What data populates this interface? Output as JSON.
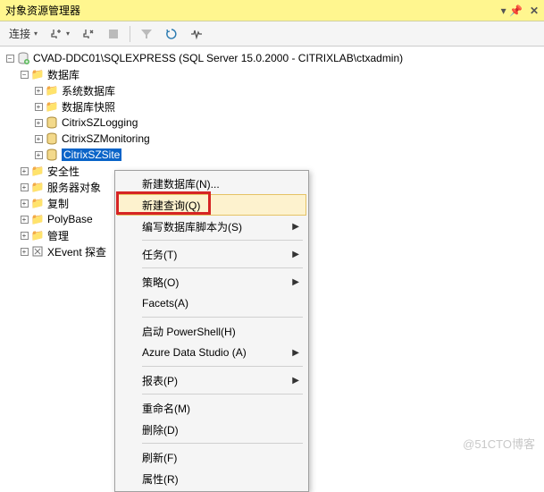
{
  "window": {
    "title": "对象资源管理器",
    "pin_icon": "📌",
    "close_icon": "✕"
  },
  "toolbar": {
    "connect_label": "连接",
    "icons": {
      "plug_add": "plug-add",
      "plug_remove": "plug-remove",
      "stop": "stop",
      "filter": "filter",
      "refresh": "refresh",
      "activity": "activity"
    }
  },
  "tree": {
    "server": "CVAD-DDC01\\SQLEXPRESS (SQL Server 15.0.2000 - CITRIXLAB\\ctxadmin)",
    "nodes": {
      "databases": "数据库",
      "sys_db": "系统数据库",
      "snapshots": "数据库快照",
      "db1": "CitrixSZLogging",
      "db2": "CitrixSZMonitoring",
      "db3": "CitrixSZSite",
      "security": "安全性",
      "server_objects": "服务器对象",
      "replication": "复制",
      "polybase": "PolyBase",
      "management": "管理",
      "xevent": "XEvent 探查"
    }
  },
  "context_menu": {
    "items": [
      {
        "label": "新建数据库(N)...",
        "submenu": false
      },
      {
        "label": "新建查询(Q)",
        "submenu": false,
        "highlight": true
      },
      {
        "label": "编写数据库脚本为(S)",
        "submenu": true
      },
      {
        "sep": true
      },
      {
        "label": "任务(T)",
        "submenu": true
      },
      {
        "sep": true
      },
      {
        "label": "策略(O)",
        "submenu": true
      },
      {
        "label": "Facets(A)",
        "submenu": false
      },
      {
        "sep": true
      },
      {
        "label": "启动 PowerShell(H)",
        "submenu": false
      },
      {
        "label": "Azure Data Studio (A)",
        "submenu": true
      },
      {
        "sep": true
      },
      {
        "label": "报表(P)",
        "submenu": true
      },
      {
        "sep": true
      },
      {
        "label": "重命名(M)",
        "submenu": false
      },
      {
        "label": "删除(D)",
        "submenu": false
      },
      {
        "sep": true
      },
      {
        "label": "刷新(F)",
        "submenu": false
      },
      {
        "label": "属性(R)",
        "submenu": false
      }
    ]
  },
  "watermark": "@51CTO博客"
}
